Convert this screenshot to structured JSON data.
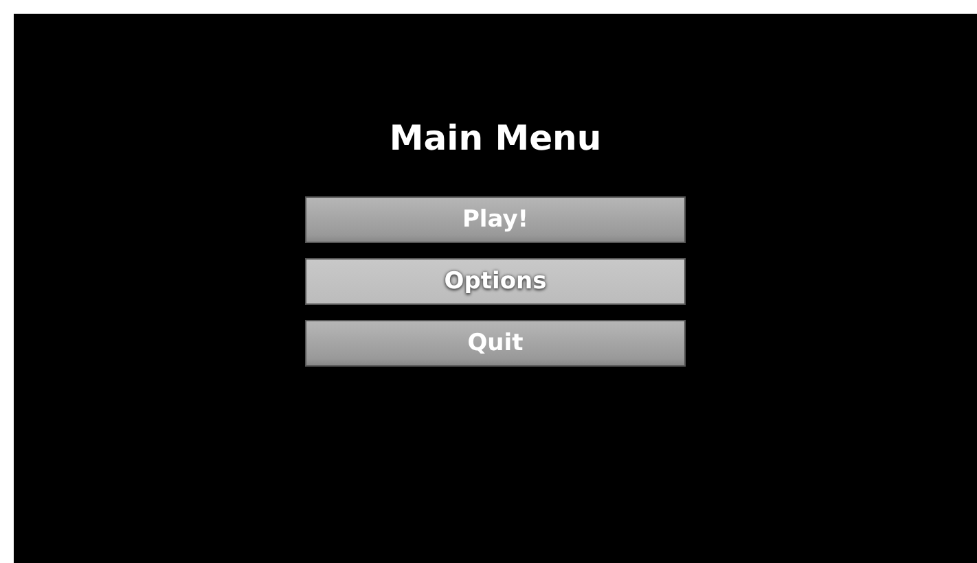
{
  "title": "Main Menu",
  "buttons": [
    {
      "label": "Play!",
      "selected": false
    },
    {
      "label": "Options",
      "selected": true
    },
    {
      "label": "Quit",
      "selected": false
    }
  ]
}
